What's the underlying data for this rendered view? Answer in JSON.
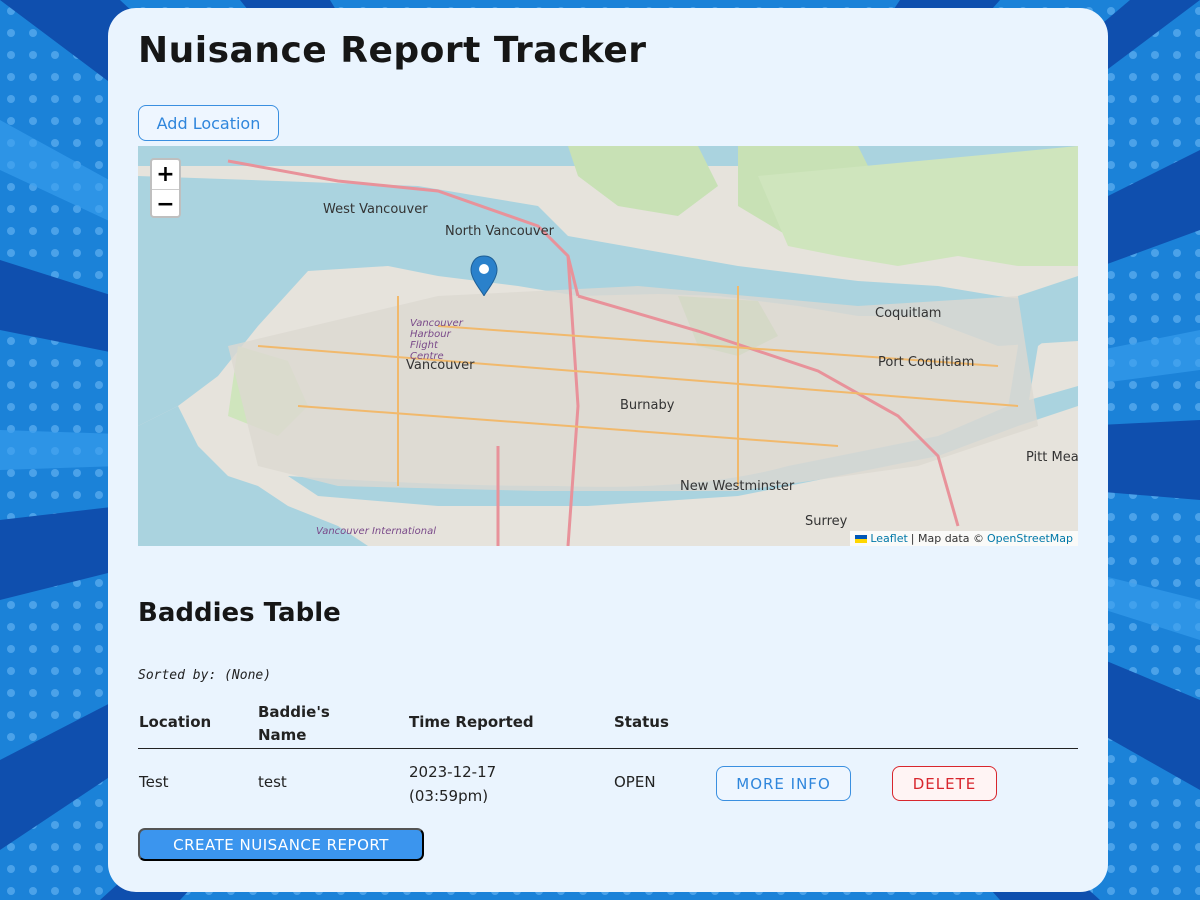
{
  "page": {
    "title": "Nuisance Report Tracker",
    "add_location_label": "Add Location"
  },
  "map": {
    "zoom_in": "+",
    "zoom_out": "−",
    "attribution": {
      "leaflet": "Leaflet",
      "separator": " | Map data © ",
      "osm": "OpenStreetMap"
    },
    "labels": [
      "West Vancouver",
      "North Vancouver",
      "Vancouver",
      "Burnaby",
      "Coquitlam",
      "Port Coquitlam",
      "New Westminster",
      "Surrey",
      "Pitt Meado",
      "Vancouver Harbour Flight Centre",
      "Vancouver International"
    ]
  },
  "table_section": {
    "heading": "Baddies Table",
    "sorted_by": "Sorted by: (None)",
    "columns": [
      "Location",
      "Baddie's Name",
      "Time Reported",
      "Status"
    ],
    "rows": [
      {
        "location": "Test",
        "name": "test",
        "time": "2023-12-17 (03:59pm)",
        "status": "OPEN",
        "more_info_label": "MORE INFO",
        "delete_label": "DELETE"
      }
    ]
  },
  "create_report_label": "CREATE NUISANCE REPORT",
  "colors": {
    "accent": "#3b95ee",
    "danger": "#d8262d",
    "card_bg": "#eaf4fe",
    "page_bg": "#1a7fd6"
  }
}
